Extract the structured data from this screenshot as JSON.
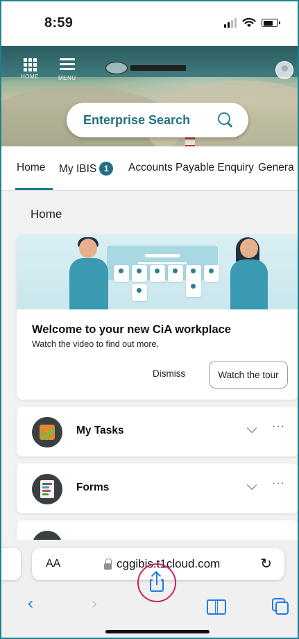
{
  "status_bar": {
    "time": "8:59"
  },
  "header": {
    "home_caption": "HOME",
    "menu_caption": "MENU",
    "search_placeholder": "Enterprise Search"
  },
  "tabs": [
    {
      "label": "Home"
    },
    {
      "label": "My IBIS",
      "badge": "1"
    },
    {
      "label": "Accounts Payable Enquiry"
    },
    {
      "label": "Genera"
    }
  ],
  "page": {
    "heading": "Home"
  },
  "welcome": {
    "title": "Welcome to your new CiA workplace",
    "subtitle": "Watch the video to find out more.",
    "dismiss_label": "Dismiss",
    "tour_label": "Watch the tour"
  },
  "widgets": [
    {
      "title": "My Tasks",
      "icon": "tasks-checkbox-icon",
      "more": "···"
    },
    {
      "title": "Forms",
      "icon": "forms-document-icon",
      "more": "···"
    }
  ],
  "browser": {
    "text_size_label": "AA",
    "url": "cggibis.t1cloud.com",
    "accent": "#1f7ae6",
    "highlight": "#d21e62"
  },
  "colors": {
    "brand": "#1f7f94",
    "search_text": "#23707f"
  }
}
